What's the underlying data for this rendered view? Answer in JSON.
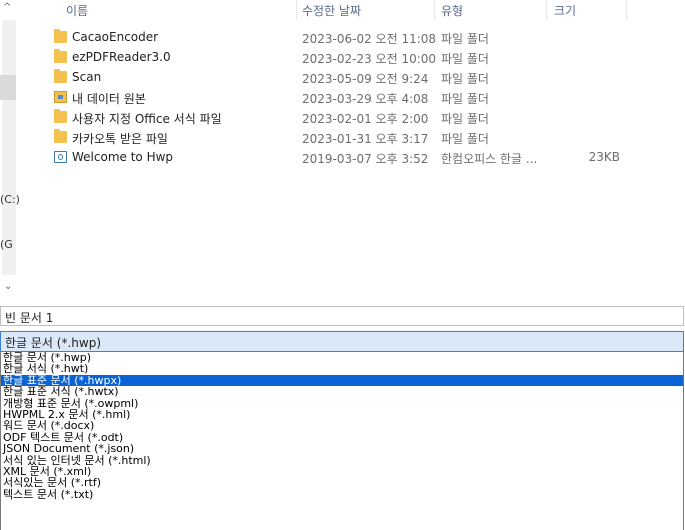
{
  "columns": {
    "name": "이름",
    "modified": "수정한 날짜",
    "type": "유형",
    "size": "크기"
  },
  "files": [
    {
      "icon": "folder-icon",
      "name": "CacaoEncoder",
      "modified": "2023-06-02 오전 11:08",
      "type": "파일 폴더",
      "size": ""
    },
    {
      "icon": "folder-icon",
      "name": "ezPDFReader3.0",
      "modified": "2023-02-23 오전 10:00",
      "type": "파일 폴더",
      "size": ""
    },
    {
      "icon": "folder-icon",
      "name": "Scan",
      "modified": "2023-05-09 오전 9:24",
      "type": "파일 폴더",
      "size": ""
    },
    {
      "icon": "image-folder-icon",
      "name": "내 데이터 원본",
      "modified": "2023-03-29 오후 4:08",
      "type": "파일 폴더",
      "size": ""
    },
    {
      "icon": "folder-icon",
      "name": "사용자 지정 Office 서식 파일",
      "modified": "2023-02-01 오후 2:00",
      "type": "파일 폴더",
      "size": ""
    },
    {
      "icon": "folder-icon",
      "name": "카카오톡 받은 파일",
      "modified": "2023-01-31 오후 3:17",
      "type": "파일 폴더",
      "size": ""
    },
    {
      "icon": "hwp-file-icon",
      "name": "Welcome to Hwp",
      "modified": "2019-03-07 오후 3:52",
      "type": "한컴오피스 한글 ...",
      "size": "23KB"
    }
  ],
  "nav": {
    "drive_c": "(C:)",
    "drive_g": "(G"
  },
  "filename": {
    "value": "빈 문서 1"
  },
  "filetype": {
    "selected": "한글 문서 (*.hwp)",
    "options": [
      "한글 문서 (*.hwp)",
      "한글 서식 (*.hwt)",
      "한글 표준 문서 (*.hwpx)",
      "한글 표준 서식 (*.hwtx)",
      "개방형 표준 문서 (*.owpml)",
      "HWPML 2.x 문서 (*.hml)",
      "워드 문서 (*.docx)",
      "ODF 텍스트 문서 (*.odt)",
      "JSON Document (*.json)",
      "서식 있는 인터넷 문서 (*.html)",
      "XML 문서 (*.xml)",
      "서식있는 문서 (*.rtf)",
      "텍스트 문서 (*.txt)"
    ],
    "highlighted_index": 2
  }
}
